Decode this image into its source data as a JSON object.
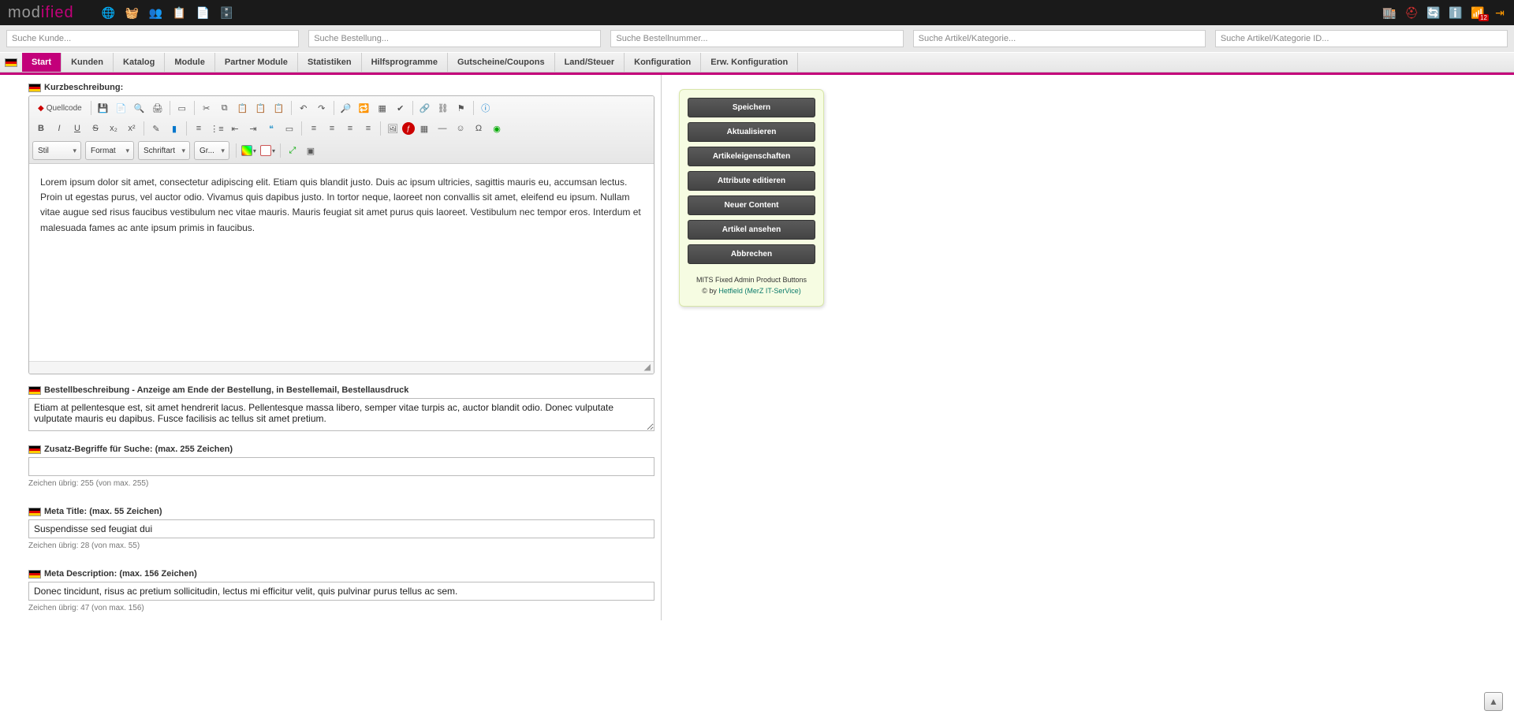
{
  "logo": {
    "part1": "mod",
    "part2": "ified"
  },
  "topIconsLeft": [
    "globe",
    "basket",
    "users",
    "list",
    "doc",
    "db"
  ],
  "topIconsRight": [
    {
      "name": "shop",
      "badge": null
    },
    {
      "name": "lifebuoy",
      "badge": null
    },
    {
      "name": "refresh",
      "badge": null
    },
    {
      "name": "info",
      "badge": null
    },
    {
      "name": "rss",
      "badge": "12"
    },
    {
      "name": "logout",
      "badge": null
    }
  ],
  "search": {
    "customer": "Suche Kunde...",
    "order": "Suche Bestellung...",
    "ordernum": "Suche Bestellnummer...",
    "article": "Suche Artikel/Kategorie...",
    "articleid": "Suche Artikel/Kategorie ID..."
  },
  "nav": {
    "items": [
      "Start",
      "Kunden",
      "Katalog",
      "Module",
      "Partner Module",
      "Statistiken",
      "Hilfsprogramme",
      "Gutscheine/Coupons",
      "Land/Steuer",
      "Konfiguration",
      "Erw. Konfiguration"
    ],
    "activeIndex": 0
  },
  "sections": {
    "short_desc_label": "Kurzbeschreibung:",
    "order_desc_label": "Bestellbeschreibung - Anzeige am Ende der Bestellung, in Bestellemail, Bestellausdruck",
    "keywords_label": "Zusatz-Begriffe für Suche: (max. 255 Zeichen)",
    "meta_title_label": "Meta Title: (max. 55 Zeichen)",
    "meta_desc_label": "Meta Description: (max. 156 Zeichen)"
  },
  "editor": {
    "source_label": "Quellcode",
    "content": "Lorem ipsum dolor sit amet, consectetur adipiscing elit. Etiam quis blandit justo. Duis ac ipsum ultricies, sagittis mauris eu, accumsan lectus. Proin ut egestas purus, vel auctor odio. Vivamus quis dapibus justo. In tortor neque, laoreet non convallis sit amet, eleifend eu ipsum. Nullam vitae augue sed risus faucibus vestibulum nec vitae mauris. Mauris feugiat sit amet purus quis laoreet. Vestibulum nec tempor eros. Interdum et malesuada fames ac ante ipsum primis in faucibus.",
    "style_sel": "Stil",
    "format_sel": "Format",
    "font_sel": "Schriftart",
    "size_sel": "Gr..."
  },
  "fields": {
    "order_desc": "Etiam at pellentesque est, sit amet hendrerit lacus. Pellentesque massa libero, semper vitae turpis ac, auctor blandit odio. Donec vulputate vulputate mauris eu dapibus. Fusce facilisis ac tellus sit amet pretium.",
    "keywords": "",
    "keywords_count": "Zeichen übrig: 255 (von max. 255)",
    "meta_title": "Suspendisse sed feugiat dui",
    "meta_title_count": "Zeichen übrig: 28 (von max. 55)",
    "meta_desc": "Donec tincidunt, risus ac pretium sollicitudin, lectus mi efficitur velit, quis pulvinar purus tellus ac sem.",
    "meta_desc_count": "Zeichen übrig: 47 (von max. 156)"
  },
  "sidebar": {
    "buttons": [
      "Speichern",
      "Aktualisieren",
      "Artikeleigenschaften",
      "Attribute editieren",
      "Neuer Content",
      "Artikel ansehen",
      "Abbrechen"
    ],
    "credit_line1": "MITS Fixed Admin Product Buttons",
    "credit_by": "© by ",
    "credit_link": "Hetfield (MerZ IT-SerVice)"
  }
}
